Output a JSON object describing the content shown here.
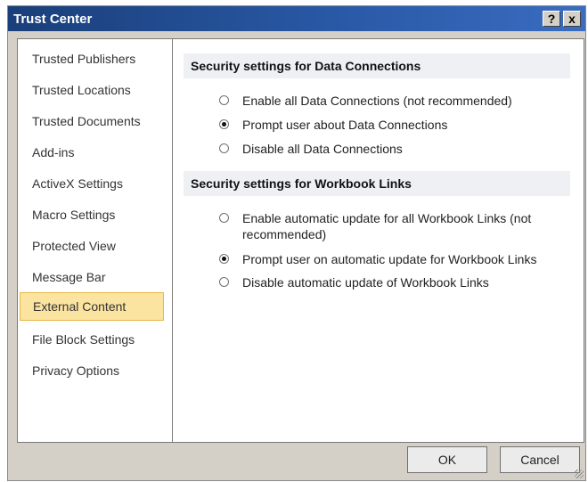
{
  "window": {
    "title": "Trust Center",
    "help_label": "?",
    "close_label": "x"
  },
  "sidebar": {
    "items": [
      {
        "label": "Trusted Publishers"
      },
      {
        "label": "Trusted Locations"
      },
      {
        "label": "Trusted Documents"
      },
      {
        "label": "Add-ins"
      },
      {
        "label": "ActiveX Settings"
      },
      {
        "label": "Macro Settings"
      },
      {
        "label": "Protected View"
      },
      {
        "label": "Message Bar"
      },
      {
        "label": "External Content"
      },
      {
        "label": "File Block Settings"
      },
      {
        "label": "Privacy Options"
      }
    ],
    "selected": "External Content"
  },
  "data_connections": {
    "header": "Security settings for Data Connections",
    "options": [
      {
        "label": "Enable all Data Connections (not recommended)",
        "checked": false
      },
      {
        "label": "Prompt user about Data Connections",
        "checked": true
      },
      {
        "label": "Disable all Data Connections",
        "checked": false
      }
    ]
  },
  "workbook_links": {
    "header": "Security settings for Workbook Links",
    "options": [
      {
        "label": "Enable automatic update for all Workbook Links (not recommended)",
        "checked": false
      },
      {
        "label": "Prompt user on automatic update for Workbook Links",
        "checked": true
      },
      {
        "label": "Disable automatic update of Workbook Links",
        "checked": false
      }
    ]
  },
  "footer": {
    "ok_label": "OK",
    "cancel_label": "Cancel"
  }
}
